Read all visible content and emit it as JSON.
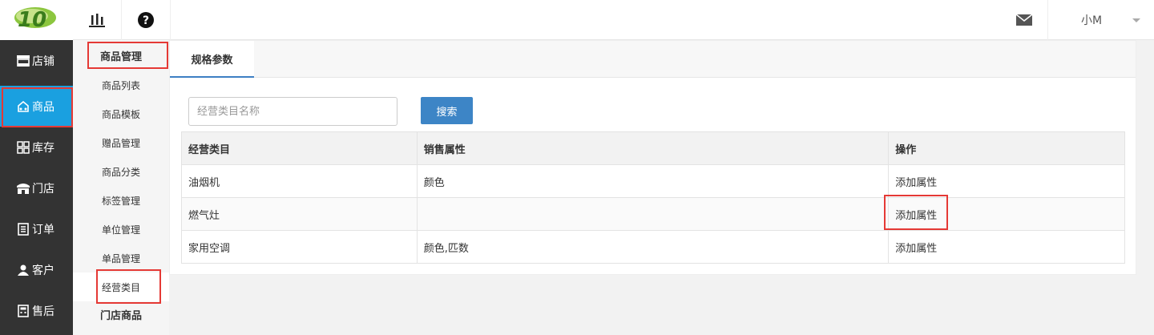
{
  "topbar": {
    "logo_text": "10",
    "user_name": "小M"
  },
  "leftnav": {
    "items": [
      {
        "label": "店铺",
        "icon": "store-icon"
      },
      {
        "label": "商品",
        "icon": "goods-icon",
        "active": true
      },
      {
        "label": "库存",
        "icon": "grid-icon"
      },
      {
        "label": "门店",
        "icon": "shop-icon"
      },
      {
        "label": "订单",
        "icon": "order-icon"
      },
      {
        "label": "客户",
        "icon": "user-icon"
      },
      {
        "label": "售后",
        "icon": "service-icon"
      }
    ]
  },
  "subnav": {
    "header": "商品管理",
    "items": [
      "商品列表",
      "商品模板",
      "赠品管理",
      "商品分类",
      "标签管理",
      "单位管理",
      "单品管理",
      "经营类目"
    ],
    "footer_header": "门店商品"
  },
  "main": {
    "tab_label": "规格参数",
    "search_placeholder": "经营类目名称",
    "search_button": "搜索",
    "table": {
      "headers": [
        "经营类目",
        "销售属性",
        "操作"
      ],
      "rows": [
        [
          "油烟机",
          "颜色",
          "添加属性"
        ],
        [
          "燃气灶",
          "",
          "添加属性"
        ],
        [
          "家用空调",
          "颜色,匹数",
          "添加属性"
        ]
      ]
    }
  },
  "colors": {
    "accent": "#1aa0e0",
    "button": "#3d85c6",
    "nav_bg": "#333333",
    "annotation": "#e53935"
  }
}
